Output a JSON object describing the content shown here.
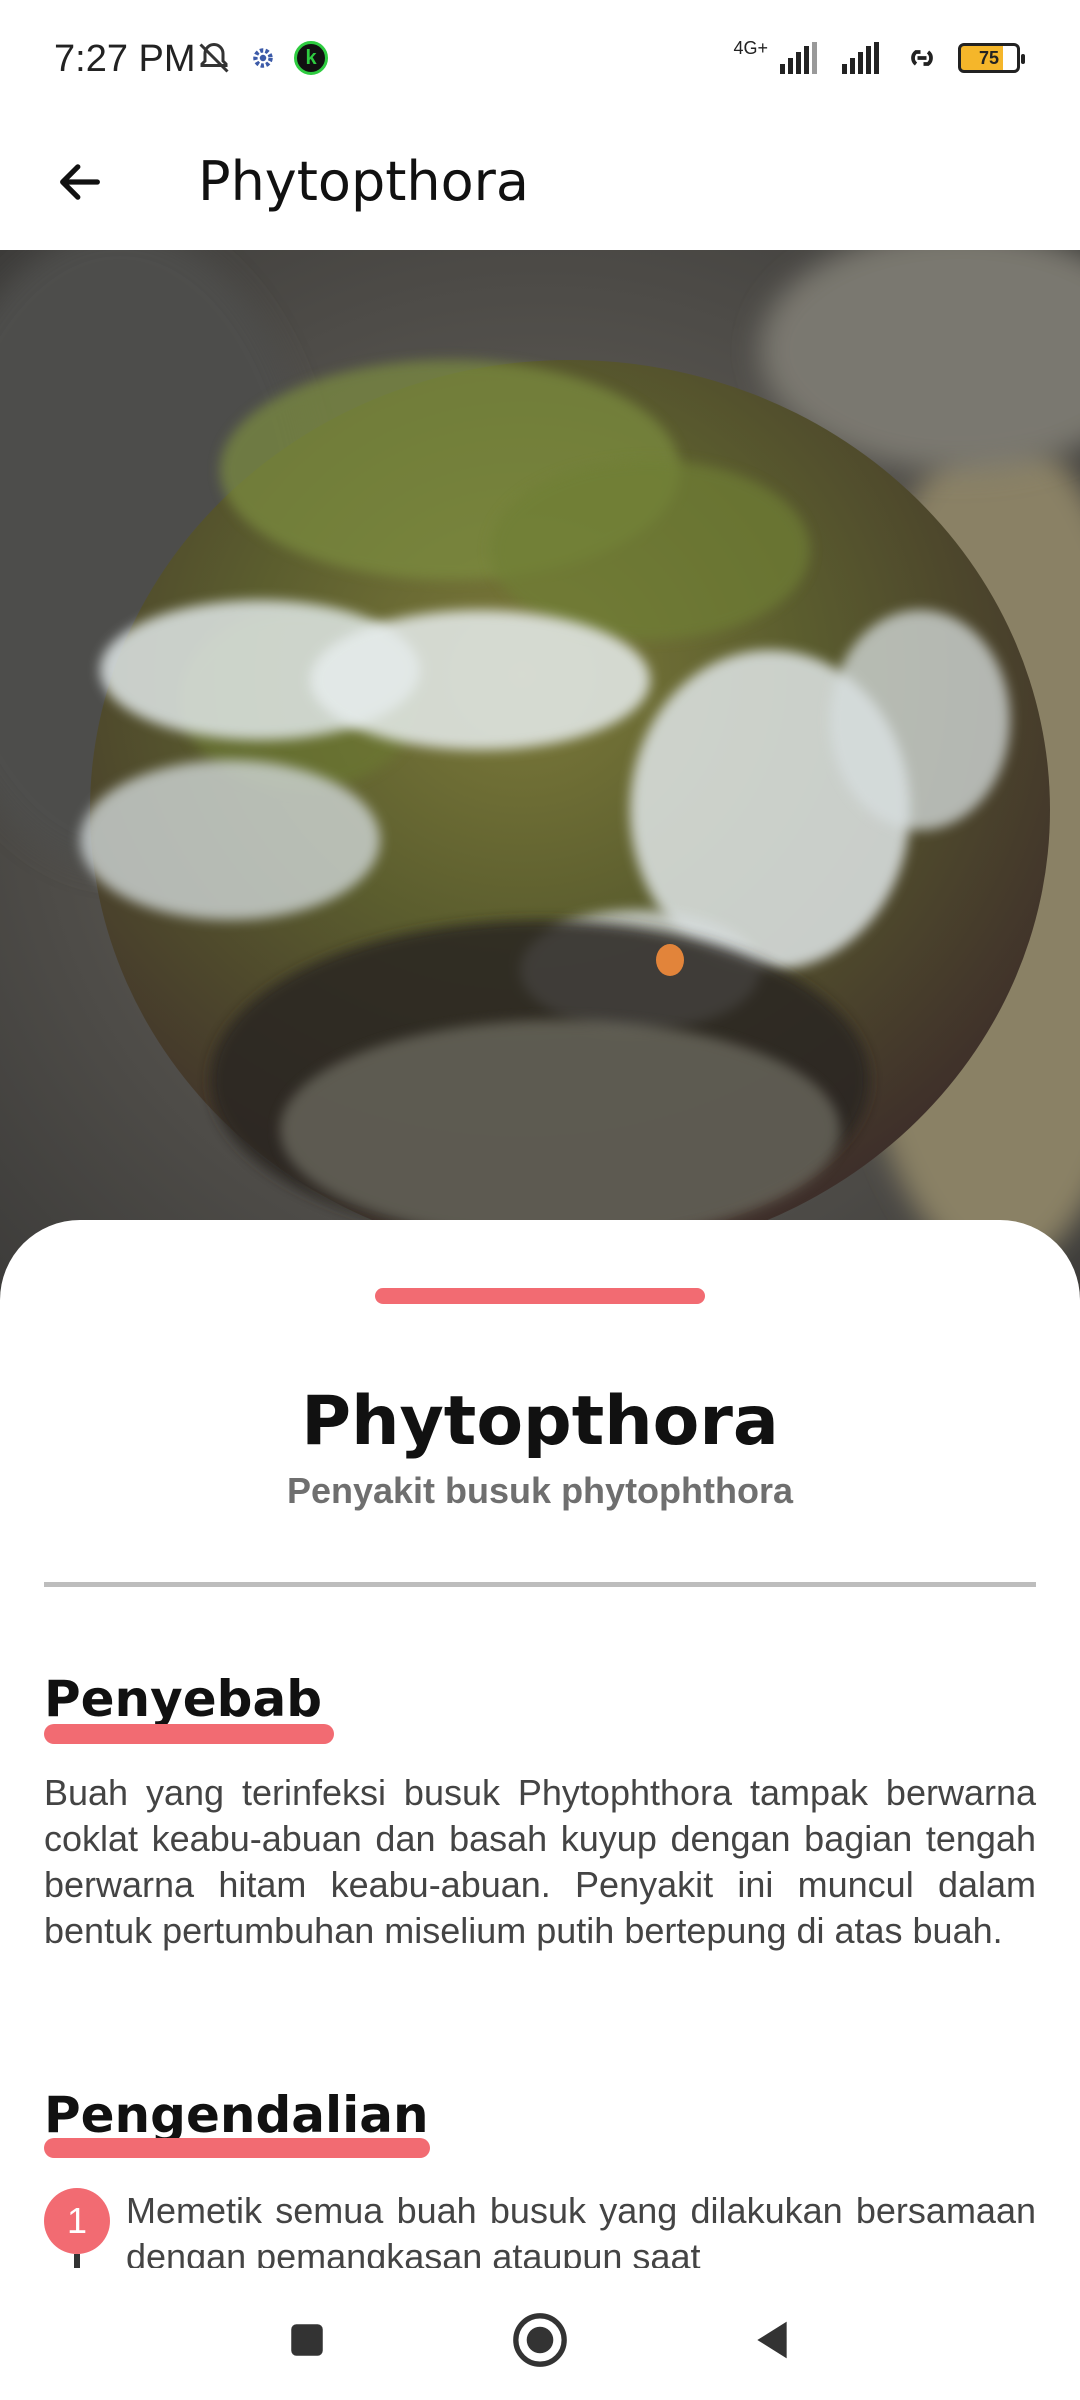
{
  "status_bar": {
    "time": "7:27 PM",
    "network": "4G+",
    "battery": "75"
  },
  "app_bar": {
    "title": "Phytopthora"
  },
  "hero_image": {
    "subject": "photo of fruit with white mold"
  },
  "sheet": {
    "title": "Phytopthora",
    "subtitle": "Penyakit busuk phytophthora",
    "sections": [
      {
        "heading": "Penyebab",
        "text": "Buah yang terinfeksi busuk Phytophthora tampak berwarna coklat keabu-abuan dan basah kuyup dengan bagian tengah berwarna hitam keabu-abuan. Penyakit ini muncul dalam bentuk pertumbuhan miselium putih bertepung di atas buah."
      },
      {
        "heading": "Pengendalian",
        "items": [
          {
            "number": "1",
            "text": "Memetik semua buah busuk yang dilakukan bersamaan dengan pemangkasan ataupun saat"
          }
        ]
      }
    ]
  },
  "colors": {
    "accent": "#f26b72",
    "divider": "#bdbdbd",
    "subtitle": "#6f6f6f"
  },
  "nav_bar": {
    "icons": [
      "recents-icon",
      "home-icon",
      "back-icon"
    ]
  }
}
